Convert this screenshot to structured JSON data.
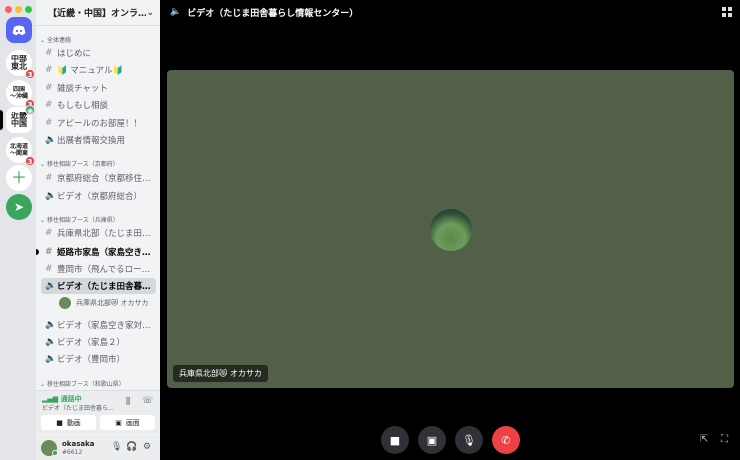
{
  "guild": {
    "name": "【近畿・中国】オンラ…"
  },
  "servers": [
    {
      "label": "中部\n東北",
      "badge": "3"
    },
    {
      "label": "四国\n〜沖縄",
      "badge": "3"
    },
    {
      "label": "近畿\n中国",
      "badge": ""
    },
    {
      "label": "北海道\n〜関東",
      "badge": "3"
    }
  ],
  "categories": {
    "all": "全体連絡",
    "kyoto": "移住相談ブース（京都府）",
    "hyogo": "移住相談ブース（兵庫県）",
    "wakayama": "移住相談ブース（和歌山県）"
  },
  "channels": {
    "hajime": "はじめに",
    "manual": "🔰 マニュアル🔰",
    "zatsudan": "雑談チャット",
    "moshimoshi": "もしもし相談",
    "appeal": "アピールのお部屋！！",
    "shutten": "出展者情報交換用",
    "kyoto_sogo": "京都府総合（京都移住…",
    "kyoto_video": "ビデオ（京都府総合）",
    "hyogo_north": "兵庫県北部（たじま田…",
    "himeji": "姫路市家島（家島空き…",
    "toyooka": "豊岡市（飛んでるロー…",
    "video_tajima": "ビデオ（たじま田舎暮…",
    "video_ieshima1": "ビデオ（家島空き家対…",
    "video_ieshima2": "ビデオ（家島２）",
    "video_toyooka": "ビデオ（豊岡市）"
  },
  "voice_member": "兵庫県北部😻 オカサカ",
  "voice_panel": {
    "status": "通話中",
    "channel": "ビデオ（たじま田舎暮ら…",
    "video_button": "動画",
    "screen_button": "画面"
  },
  "user": {
    "name": "okasaka",
    "tag": "#6612"
  },
  "main": {
    "title": "ビデオ（たじま田舎暮らし情報センター）",
    "tile_name": "兵庫県北部😻 オカサカ"
  },
  "colors": {
    "accent": "#5865f2",
    "online": "#3ba55d",
    "danger": "#ed4245",
    "tile": "#536049"
  }
}
